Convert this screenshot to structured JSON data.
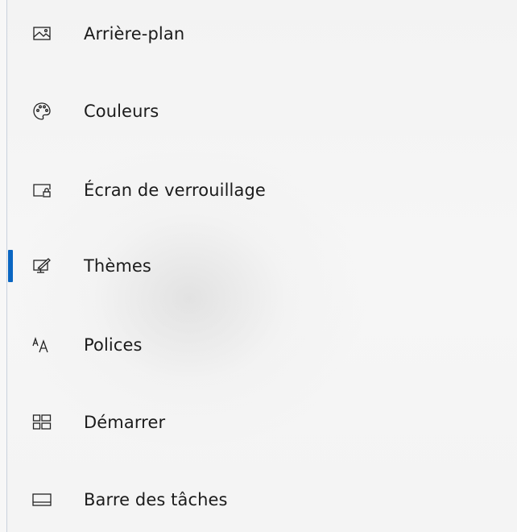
{
  "sidebar": {
    "active_index": 3,
    "accent_color": "#0a66c2",
    "items": [
      {
        "label": "Arrière-plan",
        "icon": "picture-icon"
      },
      {
        "label": "Couleurs",
        "icon": "palette-icon"
      },
      {
        "label": "Écran de verrouillage",
        "icon": "lock-screen-icon"
      },
      {
        "label": "Thèmes",
        "icon": "themes-icon"
      },
      {
        "label": "Polices",
        "icon": "fonts-icon"
      },
      {
        "label": "Démarrer",
        "icon": "start-icon"
      },
      {
        "label": "Barre des tâches",
        "icon": "taskbar-icon"
      }
    ]
  }
}
